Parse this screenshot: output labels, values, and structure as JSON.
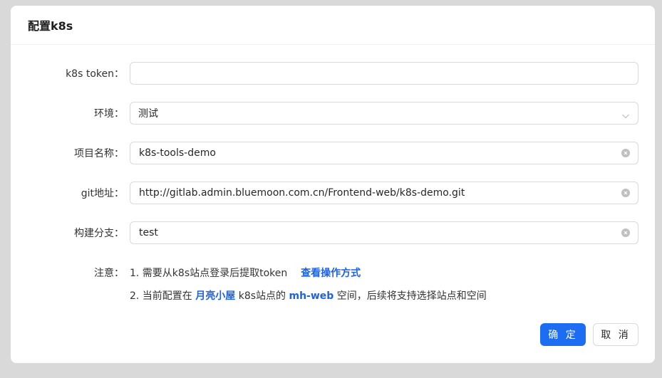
{
  "modal": {
    "title": "配置k8s",
    "ok_label": "确 定",
    "cancel_label": "取 消"
  },
  "form": {
    "token": {
      "label": "k8s token：",
      "value": ""
    },
    "env": {
      "label": "环境：",
      "value": "测试"
    },
    "project": {
      "label": "项目名称：",
      "value": "k8s-tools-demo"
    },
    "git": {
      "label": "git地址：",
      "value": "http://gitlab.admin.bluemoon.com.cn/Frontend-web/k8s-demo.git"
    },
    "branch": {
      "label": "构建分支：",
      "value": "test"
    }
  },
  "notes": {
    "label": "注意：",
    "line1_text": "1. 需要从k8s站点登录后提取token",
    "line1_link": "查看操作方式",
    "line2_pre": "2. 当前配置在",
    "line2_site": "月亮小屋",
    "line2_mid": "k8s站点的",
    "line2_space": "mh-web",
    "line2_post": "空间，后续将支持选择站点和空间"
  },
  "colors": {
    "primary": "#1d6df2",
    "link": "#1d62e6"
  },
  "icons": {
    "env_select": "chevron-down-icon",
    "clear": "clear-circle-icon"
  }
}
